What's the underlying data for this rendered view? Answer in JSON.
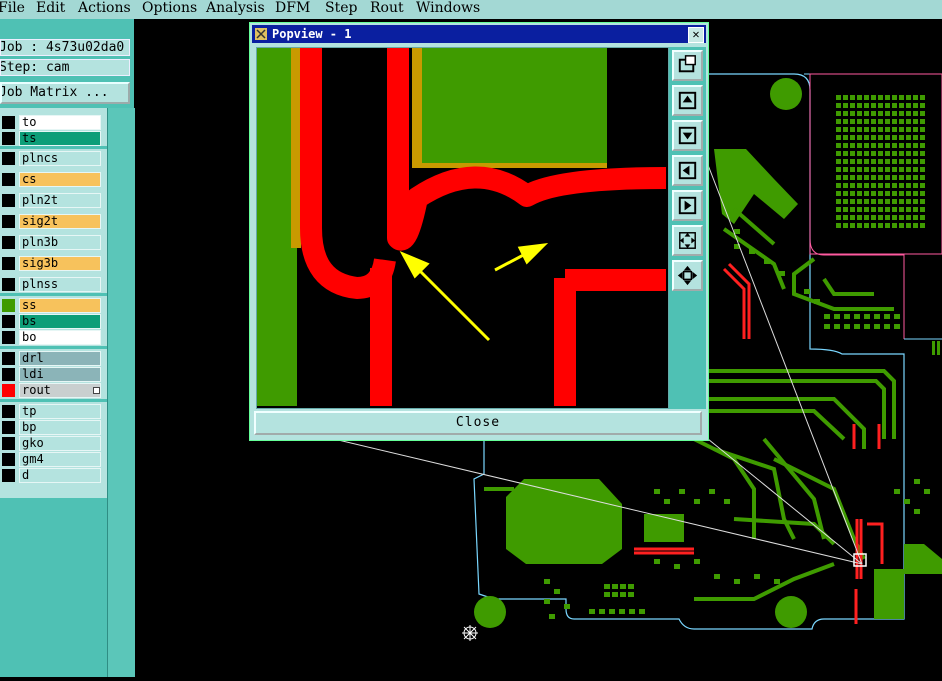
{
  "menu": [
    "File",
    "Edit",
    "Actions",
    "Options",
    "Analysis",
    "DFM",
    "Step",
    "Rout",
    "Windows"
  ],
  "job_info": {
    "job_label": "Job : 4s73u02da0",
    "step_label": "Step: cam",
    "matrix_button": "Job Matrix ..."
  },
  "layers": [
    {
      "name": "to",
      "fill": "#ffffff",
      "swatch": "#000000"
    },
    {
      "name": "ts",
      "fill": "#0d9e78",
      "swatch": "#000000"
    },
    {
      "name": "plncs",
      "fill": "#b4e3df",
      "swatch": "#000000"
    },
    {
      "name": "cs",
      "fill": "#f7c25c",
      "swatch": "#000000"
    },
    {
      "name": "pln2t",
      "fill": "#b4e3df",
      "swatch": "#000000"
    },
    {
      "name": "sig2t",
      "fill": "#f7c25c",
      "swatch": "#000000"
    },
    {
      "name": "pln3b",
      "fill": "#b4e3df",
      "swatch": "#000000"
    },
    {
      "name": "sig3b",
      "fill": "#f7c25c",
      "swatch": "#000000"
    },
    {
      "name": "plnss",
      "fill": "#b4e3df",
      "swatch": "#000000"
    },
    {
      "name": "ss",
      "fill": "#f7c25c",
      "swatch": "#3f9b00"
    },
    {
      "name": "bs",
      "fill": "#0d9e78",
      "swatch": "#000000"
    },
    {
      "name": "bo",
      "fill": "#ffffff",
      "swatch": "#000000"
    },
    {
      "name": "drl",
      "fill": "#8bb4b8",
      "swatch": "#000000"
    },
    {
      "name": "ldi",
      "fill": "#8bb4b8",
      "swatch": "#000000"
    },
    {
      "name": "rout",
      "fill": "#c9cfcf",
      "swatch": "#ff0000"
    },
    {
      "name": "tp",
      "fill": "#b4e3df",
      "swatch": "#000000"
    },
    {
      "name": "bp",
      "fill": "#b4e3df",
      "swatch": "#000000"
    },
    {
      "name": "gko",
      "fill": "#b4e3df",
      "swatch": "#000000"
    },
    {
      "name": "gm4",
      "fill": "#b4e3df",
      "swatch": "#000000"
    },
    {
      "name": "d",
      "fill": "#b4e3df",
      "swatch": "#000000"
    }
  ],
  "popview": {
    "title": "Popview - 1",
    "close_button": "Close",
    "close_glyph": "✕",
    "tools": [
      "zoom-fit-icon",
      "pan-up-icon",
      "pan-down-icon",
      "pan-left-icon",
      "pan-right-icon",
      "zoom-in-icon",
      "zoom-out-icon"
    ]
  },
  "colors": {
    "copper": "#3f9b00",
    "rout": "#ff0000",
    "highlight": "#ffff00",
    "panel": "#4fc1b4",
    "panel_light": "#b4e3df",
    "titlebar": "#0a1fa0"
  }
}
